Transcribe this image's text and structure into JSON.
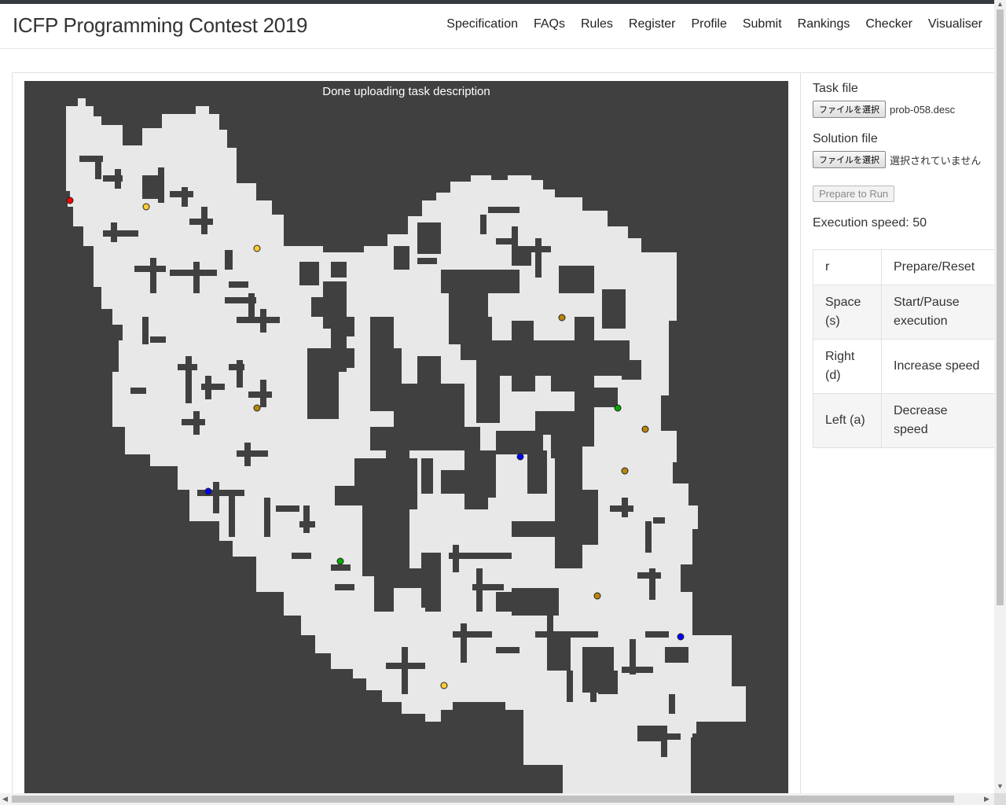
{
  "header": {
    "brand": "ICFP Programming Contest 2019",
    "nav": [
      "Specification",
      "FAQs",
      "Rules",
      "Register",
      "Profile",
      "Submit",
      "Rankings",
      "Checker",
      "Visualiser"
    ]
  },
  "visualiser": {
    "status": "Done uploading task description",
    "colors": {
      "background": "#404040",
      "map": "#e8e8e8",
      "obstacle": "#404040",
      "robot": "#ff0000",
      "booster_b": "#ffcc33",
      "booster_f": "#b8860b",
      "booster_l": "#00aa00",
      "booster_x": "#0000ff"
    }
  },
  "panel": {
    "task_label": "Task file",
    "task_button": "ファイルを選択",
    "task_filename": "prob-058.desc",
    "solution_label": "Solution file",
    "solution_button": "ファイルを選択",
    "solution_filename": "選択されていません",
    "run_button": "Prepare to Run",
    "speed_text": "Execution speed: 50"
  },
  "shortcuts": [
    {
      "key": "r",
      "action": "Prepare/Reset"
    },
    {
      "key": "Space (s)",
      "action": "Start/Pause execution"
    },
    {
      "key": "Right (d)",
      "action": "Increase speed"
    },
    {
      "key": "Left (a)",
      "action": "Decrease speed"
    }
  ]
}
